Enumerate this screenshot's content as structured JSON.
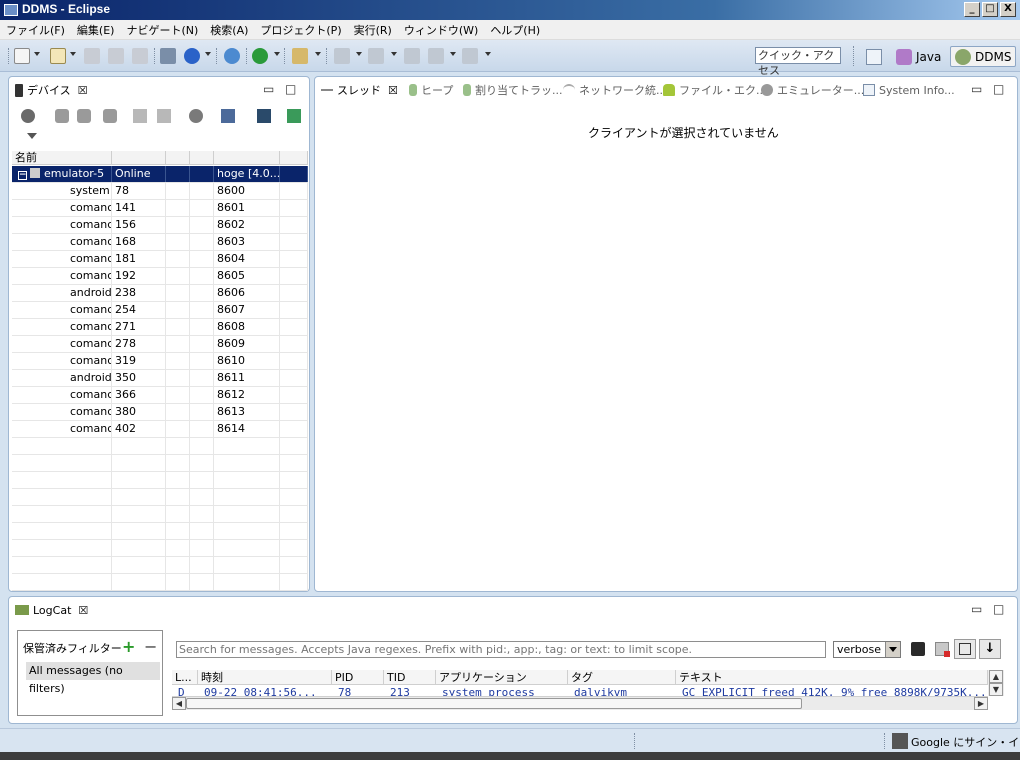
{
  "window": {
    "title": "DDMS - Eclipse",
    "btn_min": "_",
    "btn_max": "□",
    "btn_close": "X"
  },
  "menu": [
    "ファイル(F)",
    "編集(E)",
    "ナビゲート(N)",
    "検索(A)",
    "プロジェクト(P)",
    "実行(R)",
    "ウィンドウ(W)",
    "ヘルプ(H)"
  ],
  "toolbar": {
    "quick_access": "クイック・アクセス"
  },
  "perspectives": {
    "java": "Java",
    "ddms": "DDMS"
  },
  "devices": {
    "tab_label": "デバイス",
    "columns": [
      "名前",
      "",
      "",
      "",
      "",
      ""
    ],
    "device": {
      "name": "emulator-5",
      "status": "Online",
      "target": "hoge [4.0..."
    },
    "processes": [
      {
        "name": "system",
        "pid": "78",
        "port": "8600"
      },
      {
        "name": "comanc",
        "pid": "141",
        "port": "8601"
      },
      {
        "name": "comanc",
        "pid": "156",
        "port": "8602"
      },
      {
        "name": "comanc",
        "pid": "168",
        "port": "8603"
      },
      {
        "name": "comanc",
        "pid": "181",
        "port": "8604"
      },
      {
        "name": "comanc",
        "pid": "192",
        "port": "8605"
      },
      {
        "name": "android",
        "pid": "238",
        "port": "8606"
      },
      {
        "name": "comanc",
        "pid": "254",
        "port": "8607"
      },
      {
        "name": "comanc",
        "pid": "271",
        "port": "8608"
      },
      {
        "name": "comanc",
        "pid": "278",
        "port": "8609"
      },
      {
        "name": "comanc",
        "pid": "319",
        "port": "8610"
      },
      {
        "name": "android",
        "pid": "350",
        "port": "8611"
      },
      {
        "name": "comanc",
        "pid": "366",
        "port": "8612"
      },
      {
        "name": "comanc",
        "pid": "380",
        "port": "8613"
      },
      {
        "name": "comanc",
        "pid": "402",
        "port": "8614"
      }
    ]
  },
  "right_tabs": [
    "スレッド",
    "ヒープ",
    "割り当てトラッ...",
    "ネットワーク統...",
    "ファイル・エク...",
    "エミュレーター...",
    "System Info..."
  ],
  "threads": {
    "empty_message": "クライアントが選択されていません"
  },
  "logcat": {
    "tab_label": "LogCat",
    "saved_filters_label": "保管済みフィルター",
    "all_messages": "All messages (no filters)",
    "search_placeholder": "Search for messages. Accepts Java regexes. Prefix with pid:, app:, tag: or text: to limit scope.",
    "level": "verbose",
    "columns": [
      "L...",
      "時刻",
      "PID",
      "TID",
      "アプリケーション",
      "タグ",
      "テキスト"
    ],
    "rows": [
      {
        "level": "D",
        "time": "09-22 08:41:56...",
        "pid": "78",
        "tid": "213",
        "app": "system_process",
        "tag": "dalvikvm",
        "text": "GC_EXPLICIT freed 412K, 9% free 8898K/9735K..."
      }
    ]
  },
  "status": {
    "google_signin": "Google にサイン・イン..."
  }
}
